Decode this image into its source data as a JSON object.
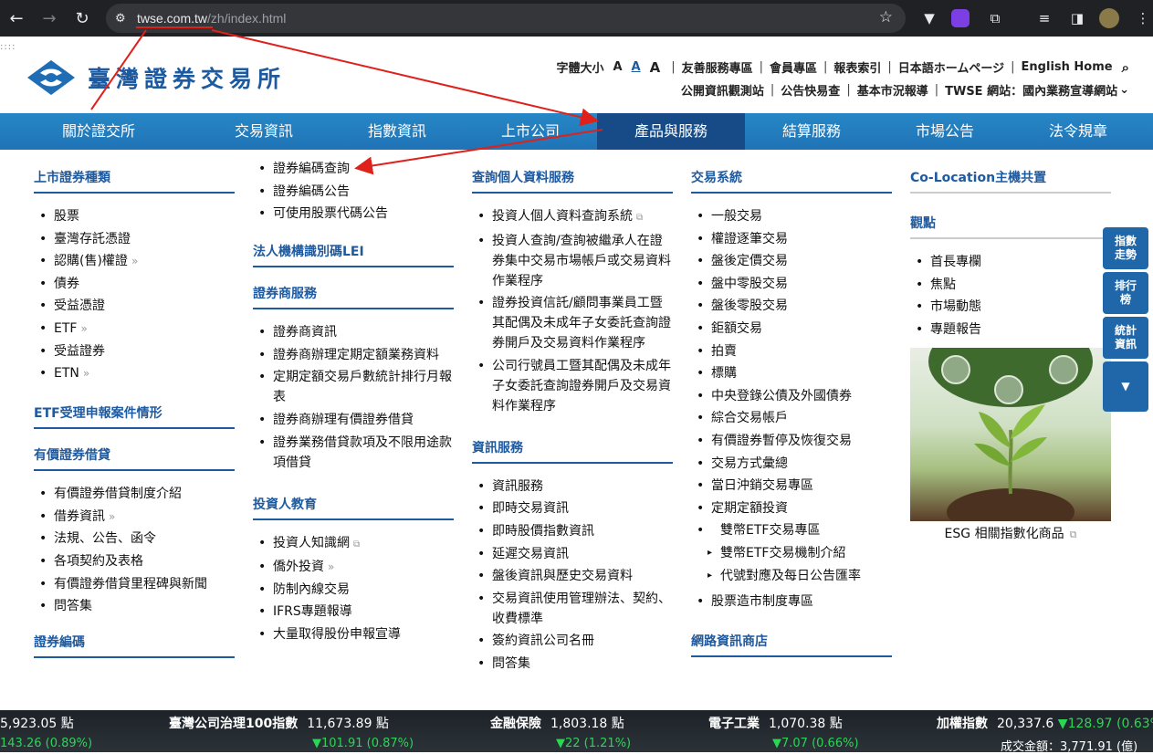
{
  "browser": {
    "url_host": "twse.com.tw",
    "url_path": "/zh/index.html"
  },
  "site": {
    "logo_text": "臺灣證券交易所",
    "font_size_label": "字體大小",
    "font_sizes": [
      "A",
      "A",
      "A"
    ],
    "util_links_1": [
      "友善服務專區",
      "會員專區",
      "報表索引",
      "日本語ホームページ",
      "English Home"
    ],
    "util_links_2": [
      "公開資訊觀測站",
      "公告快易查",
      "基本市況報導",
      "TWSE 網站：國內業務宣導網站"
    ]
  },
  "nav": [
    "關於證交所",
    "交易資訊",
    "指數資訊",
    "上市公司",
    "產品與服務",
    "結算服務",
    "市場公告",
    "法令規章"
  ],
  "col1": {
    "title1": "上市證券種類",
    "items1": [
      "股票",
      "臺灣存託憑證",
      "認購(售)權證",
      "債券",
      "受益憑證",
      "ETF",
      "受益證券",
      "ETN"
    ],
    "title2": "ETF受理申報案件情形",
    "title3": "有價證券借貸",
    "items3": [
      "有價證券借貸制度介紹",
      "借券資訊",
      "法規、公告、函令",
      "各項契約及表格",
      "有價證券借貸里程碑與新聞",
      "問答集"
    ],
    "title4": "證券編碼"
  },
  "col2": {
    "items0": [
      "證券編碼查詢",
      "證券編碼公告",
      "可使用股票代碼公告"
    ],
    "title1": "法人機構識別碼LEI",
    "title2": "證券商服務",
    "items2": [
      "證券商資訊",
      "證券商辦理定期定額業務資料",
      "定期定額交易戶數統計排行月報表",
      "證券商辦理有價證券借貸",
      "證券業務借貸款項及不限用途款項借貸"
    ],
    "title3": "投資人教育",
    "items3": [
      "投資人知識網",
      "僑外投資",
      "防制內線交易",
      "IFRS專題報導",
      "大量取得股份申報宣導"
    ]
  },
  "col3": {
    "title1": "查詢個人資料服務",
    "items1": [
      "投資人個人資料查詢系統",
      "投資人查詢/查詢被繼承人在證券集中交易市場帳戶或交易資料作業程序",
      "證券投資信託/顧問事業員工暨其配偶及未成年子女委託查詢證券開戶及交易資料作業程序",
      "公司行號員工暨其配偶及未成年子女委託查詢證券開戶及交易資料作業程序"
    ],
    "title2": "資訊服務",
    "items2": [
      "資訊服務",
      "即時交易資訊",
      "即時股價指數資訊",
      "延遲交易資訊",
      "盤後資訊與歷史交易資料",
      "交易資訊使用管理辦法、契約、收費標準",
      "簽約資訊公司名冊",
      "問答集"
    ]
  },
  "col4": {
    "title1": "交易系統",
    "items1": [
      "一般交易",
      "權證逐筆交易",
      "盤後定價交易",
      "盤中零股交易",
      "盤後零股交易",
      "鉅額交易",
      "拍賣",
      "標購",
      "中央登錄公債及外國債券",
      "綜合交易帳戶",
      "有價證券暫停及恢復交易",
      "交易方式彙總",
      "當日沖銷交易專區",
      "定期定額投資",
      "雙幣ETF交易專區"
    ],
    "sub": [
      "雙幣ETF交易機制介紹",
      "代號對應及每日公告匯率"
    ],
    "items1b": [
      "股票造市制度專區"
    ],
    "title2": "網路資訊商店"
  },
  "col5": {
    "title1": "Co-Location主機共置",
    "title2": "觀點",
    "items2": [
      "首長專欄",
      "焦點",
      "市場動態",
      "專題報告"
    ],
    "esg_caption": "ESG 相關指數化商品"
  },
  "side_buttons": [
    "指數\n走勢",
    "排行\n榜",
    "統計\n資訊",
    "▼"
  ],
  "ticker": {
    "row1": [
      {
        "value": "5,923.05 點"
      },
      {
        "name": "臺灣公司治理100指數",
        "value": "11,673.89 點"
      },
      {
        "name": "金融保險",
        "value": "1,803.18 點"
      },
      {
        "name": "電子工業",
        "value": "1,070.38 點"
      },
      {
        "name": "加權指數",
        "value": "20,337.6",
        "change": "▼128.97 (0.63%"
      }
    ],
    "row2": [
      "143.26 (0.89%)",
      "▼101.91 (0.87%)",
      "▼22 (1.21%)",
      "▼7.07 (0.66%)",
      "成交金額：3,771.91 (億)"
    ]
  },
  "colors": {
    "brand": "#1e5aa0",
    "nav": "#1f73b6",
    "active": "#164b87",
    "annotation": "#e0201a",
    "up": "#2bd655"
  }
}
